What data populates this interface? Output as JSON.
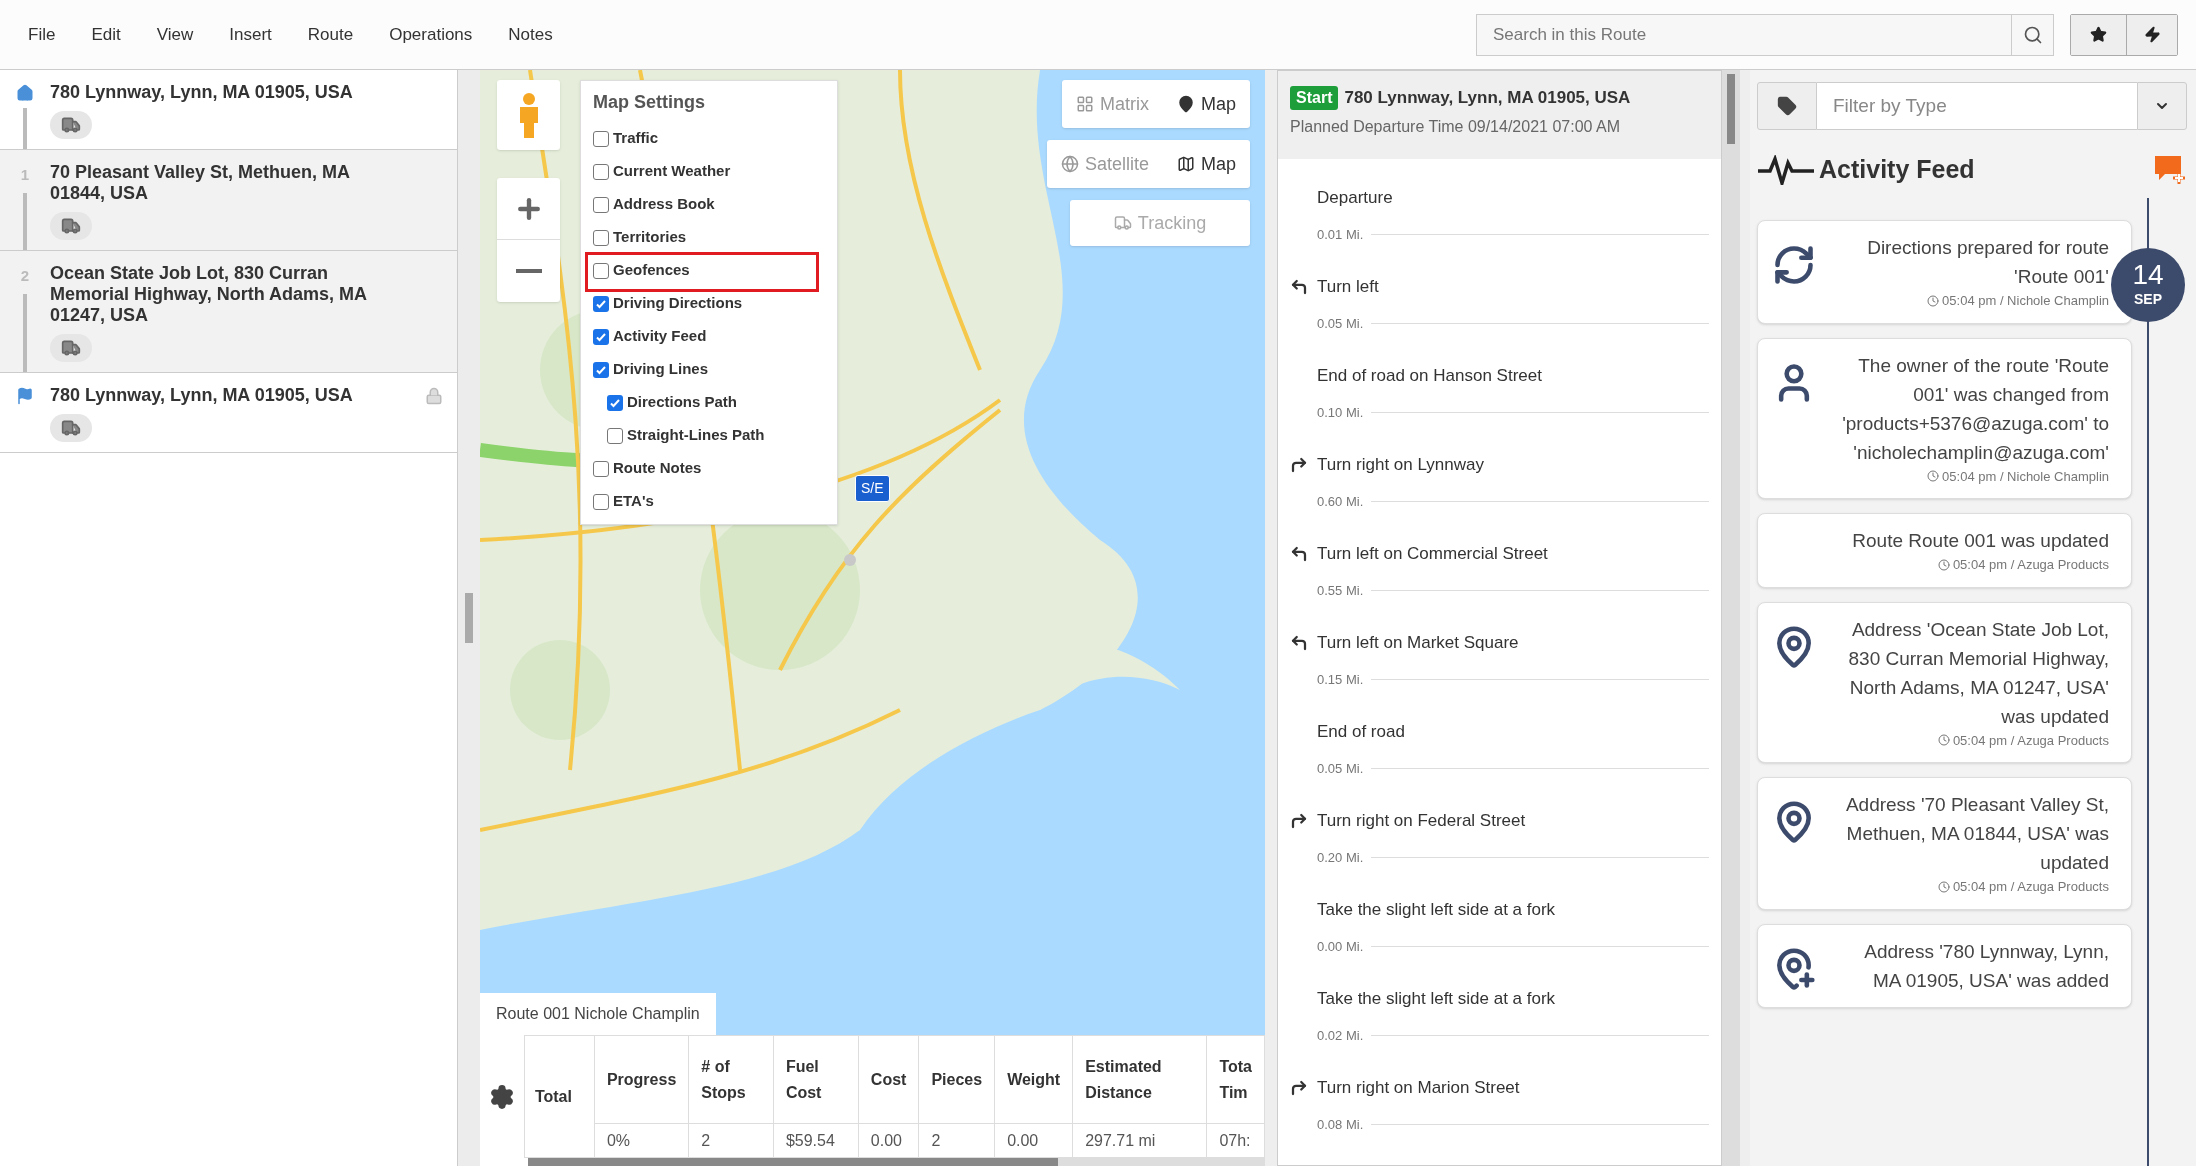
{
  "menu": [
    "File",
    "Edit",
    "View",
    "Insert",
    "Route",
    "Operations",
    "Notes"
  ],
  "search": {
    "placeholder": "Search in this Route"
  },
  "stops": [
    {
      "kind": "home",
      "address": "780 Lynnway, Lynn, MA 01905, USA",
      "locked": false
    },
    {
      "kind": "stop",
      "number": "1",
      "address": "70 Pleasant Valley St, Methuen, MA 01844, USA",
      "locked": false
    },
    {
      "kind": "stop",
      "number": "2",
      "address": "Ocean State Job Lot, 830 Curran Memorial Highway, North Adams, MA 01247, USA",
      "locked": false
    },
    {
      "kind": "end",
      "address": "780 Lynnway, Lynn, MA 01905, USA",
      "locked": true
    }
  ],
  "map": {
    "mode_toggle": [
      {
        "label": "Matrix",
        "selected": false
      },
      {
        "label": "Map",
        "selected": true
      }
    ],
    "view_toggle": [
      {
        "label": "Satellite",
        "selected": false
      },
      {
        "label": "Map",
        "selected": true
      }
    ],
    "tracking": {
      "label": "Tracking",
      "disabled": true
    },
    "marker": "S/E",
    "settings": {
      "title": "Map Settings",
      "options": [
        {
          "label": "Traffic",
          "checked": false,
          "highlighted": false
        },
        {
          "label": "Current Weather",
          "checked": false,
          "highlighted": false
        },
        {
          "label": "Address Book",
          "checked": false,
          "highlighted": false
        },
        {
          "label": "Territories",
          "checked": false,
          "highlighted": false
        },
        {
          "label": "Geofences",
          "checked": false,
          "highlighted": true
        },
        {
          "label": "Driving Directions",
          "checked": true,
          "highlighted": false
        },
        {
          "label": "Activity Feed",
          "checked": true,
          "highlighted": false
        },
        {
          "label": "Driving Lines",
          "checked": true,
          "highlighted": false,
          "children": [
            {
              "label": "Directions Path",
              "checked": true,
              "highlighted": false
            },
            {
              "label": "Straight-Lines Path",
              "checked": false,
              "highlighted": false
            }
          ]
        },
        {
          "label": "Route Notes",
          "checked": false,
          "highlighted": false
        },
        {
          "label": "ETA's",
          "checked": false,
          "highlighted": false
        }
      ]
    }
  },
  "route_tab": {
    "label": "Route 001 Nichole Champlin",
    "selected": true
  },
  "summary_table": {
    "row_header": "Total",
    "columns": [
      "Progress",
      "# of Stops",
      "Fuel Cost",
      "Cost",
      "Pieces",
      "Weight",
      "Estimated Distance",
      "Tota Tim"
    ],
    "row": [
      "0%",
      "2",
      "$59.54",
      "0.00",
      "2",
      "0.00",
      "297.71 mi",
      "07h:"
    ]
  },
  "directions": {
    "badge": "Start",
    "address": "780 Lynnway, Lynn, MA 01905, USA",
    "planned": "Planned Departure Time 09/14/2021 07:00 AM",
    "steps": [
      {
        "kind": "straight",
        "text": "Departure",
        "distance": "0.01 Mi."
      },
      {
        "kind": "left",
        "text": "Turn left",
        "distance": "0.05 Mi."
      },
      {
        "kind": "straight",
        "text": "End of road on Hanson Street",
        "distance": "0.10 Mi."
      },
      {
        "kind": "right",
        "text": "Turn right on Lynnway",
        "distance": "0.60 Mi."
      },
      {
        "kind": "left",
        "text": "Turn left on Commercial Street",
        "distance": "0.55 Mi."
      },
      {
        "kind": "left",
        "text": "Turn left on Market Square",
        "distance": "0.15 Mi."
      },
      {
        "kind": "straight",
        "text": "End of road",
        "distance": "0.05 Mi."
      },
      {
        "kind": "right",
        "text": "Turn right on Federal Street",
        "distance": "0.20 Mi."
      },
      {
        "kind": "straight",
        "text": "Take the slight left side at a fork",
        "distance": "0.00 Mi."
      },
      {
        "kind": "straight",
        "text": "Take the slight left side at a fork",
        "distance": "0.02 Mi."
      },
      {
        "kind": "right",
        "text": "Turn right on Marion Street",
        "distance": "0.08 Mi."
      }
    ]
  },
  "activity": {
    "filter_placeholder": "Filter by Type",
    "title": "Activity Feed",
    "day": "14",
    "month": "SEP",
    "items": [
      {
        "kind": "sync",
        "text": "Directions prepared for route 'Route 001'",
        "meta": "05:04 pm / Nichole Champlin"
      },
      {
        "kind": "owner",
        "text": "The owner of the route 'Route 001' was changed from 'products+5376@azuga.com' to 'nicholechamplin@azuga.com'",
        "meta": "05:04 pm / Nichole Champlin"
      },
      {
        "kind": "none",
        "text": "Route Route 001 was updated",
        "meta": "05:04 pm / Azuga Products"
      },
      {
        "kind": "address-updated",
        "text": "Address 'Ocean State Job Lot, 830 Curran Memorial Highway, North Adams, MA 01247, USA' was updated",
        "meta": "05:04 pm / Azuga Products"
      },
      {
        "kind": "address-updated",
        "text": "Address '70 Pleasant Valley St, Methuen, MA 01844, USA' was updated",
        "meta": "05:04 pm / Azuga Products"
      },
      {
        "kind": "address-added",
        "text": "Address '780 Lynnway, Lynn, MA 01905, USA' was added"
      }
    ]
  }
}
